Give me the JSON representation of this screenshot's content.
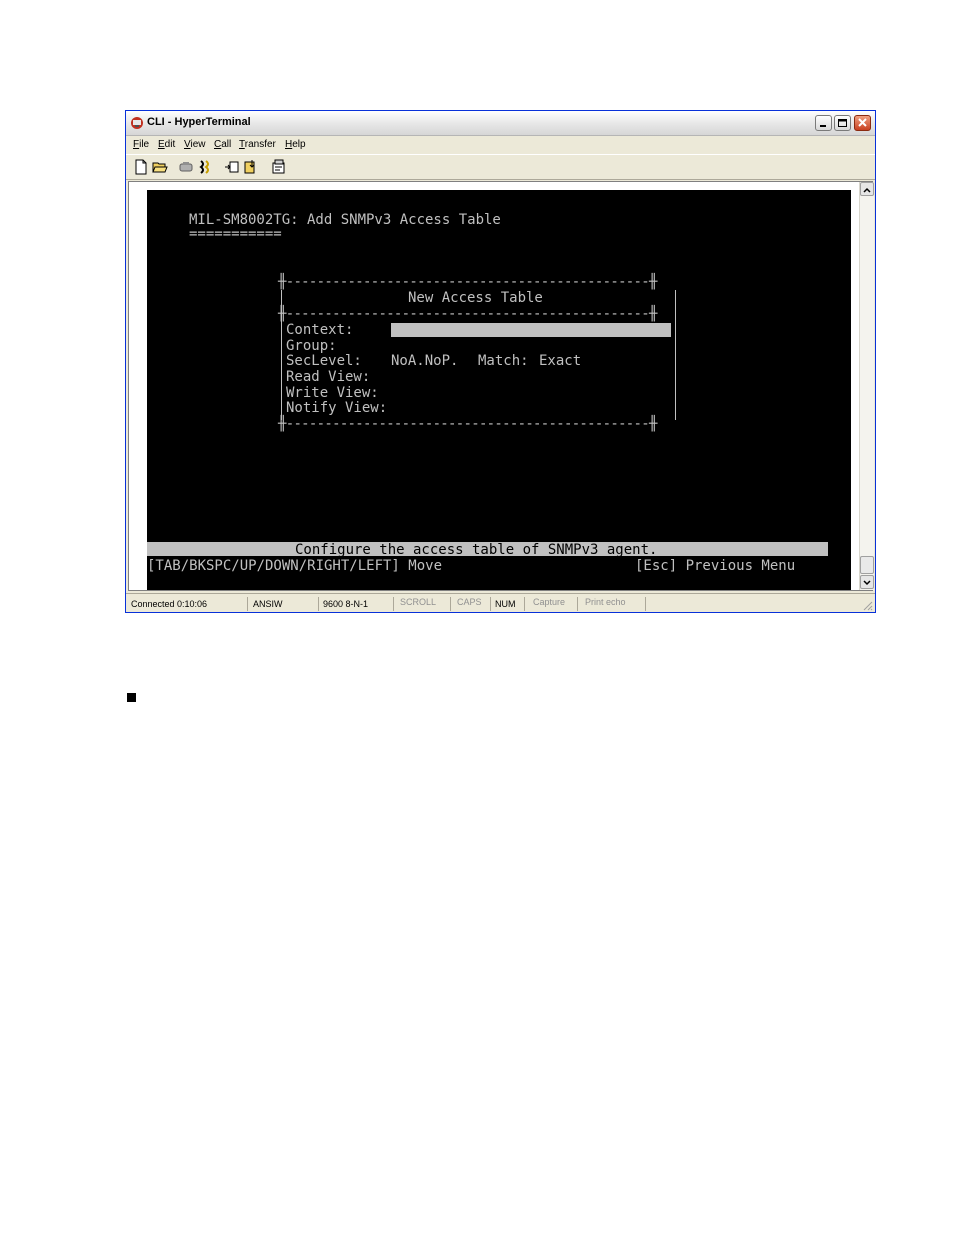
{
  "window": {
    "title": "CLI - HyperTerminal"
  },
  "menu": [
    {
      "pre": "",
      "key": "F",
      "rest": "ile"
    },
    {
      "pre": "",
      "key": "E",
      "rest": "dit"
    },
    {
      "pre": "",
      "key": "V",
      "rest": "iew"
    },
    {
      "pre": "",
      "key": "C",
      "rest": "all"
    },
    {
      "pre": "",
      "key": "T",
      "rest": "ransfer"
    },
    {
      "pre": "",
      "key": "H",
      "rest": "elp"
    }
  ],
  "toolbar_icons": [
    "new-icon",
    "open-icon",
    "disconnect-icon",
    "call-icon",
    "send-icon",
    "receive-icon",
    "properties-icon"
  ],
  "terminal": {
    "header": "MIL-SM8002TG: Add SNMPv3 Access Table",
    "header_underline": "===========",
    "box_top": "╫-----------------------------------------------╫",
    "box_title": "New Access Table",
    "box_divider": "╫-----------------------------------------------╫",
    "box_bottom": "╫-----------------------------------------------╫",
    "fields": {
      "context_label": "Context:",
      "group_label": "Group:",
      "seclevel_label": "SecLevel:",
      "seclevel_value": "NoA.NoP.",
      "match_label": "Match:",
      "match_value": "Exact",
      "read_view_label": "Read View:",
      "write_view_label": "Write View:",
      "notify_view_label": "Notify View:"
    },
    "status_message": "Configure the access table of SNMPv3 agent.",
    "help_keys": "[TAB/BKSPC/UP/DOWN/RIGHT/LEFT] Move",
    "help_esc": "[Esc] Previous Menu"
  },
  "statusbar": {
    "connected": "Connected 0:10:06",
    "emulation": "ANSIW",
    "port": "9600 8-N-1",
    "scroll": "SCROLL",
    "caps": "CAPS",
    "num": "NUM",
    "capture": "Capture",
    "print_echo": "Print echo"
  }
}
